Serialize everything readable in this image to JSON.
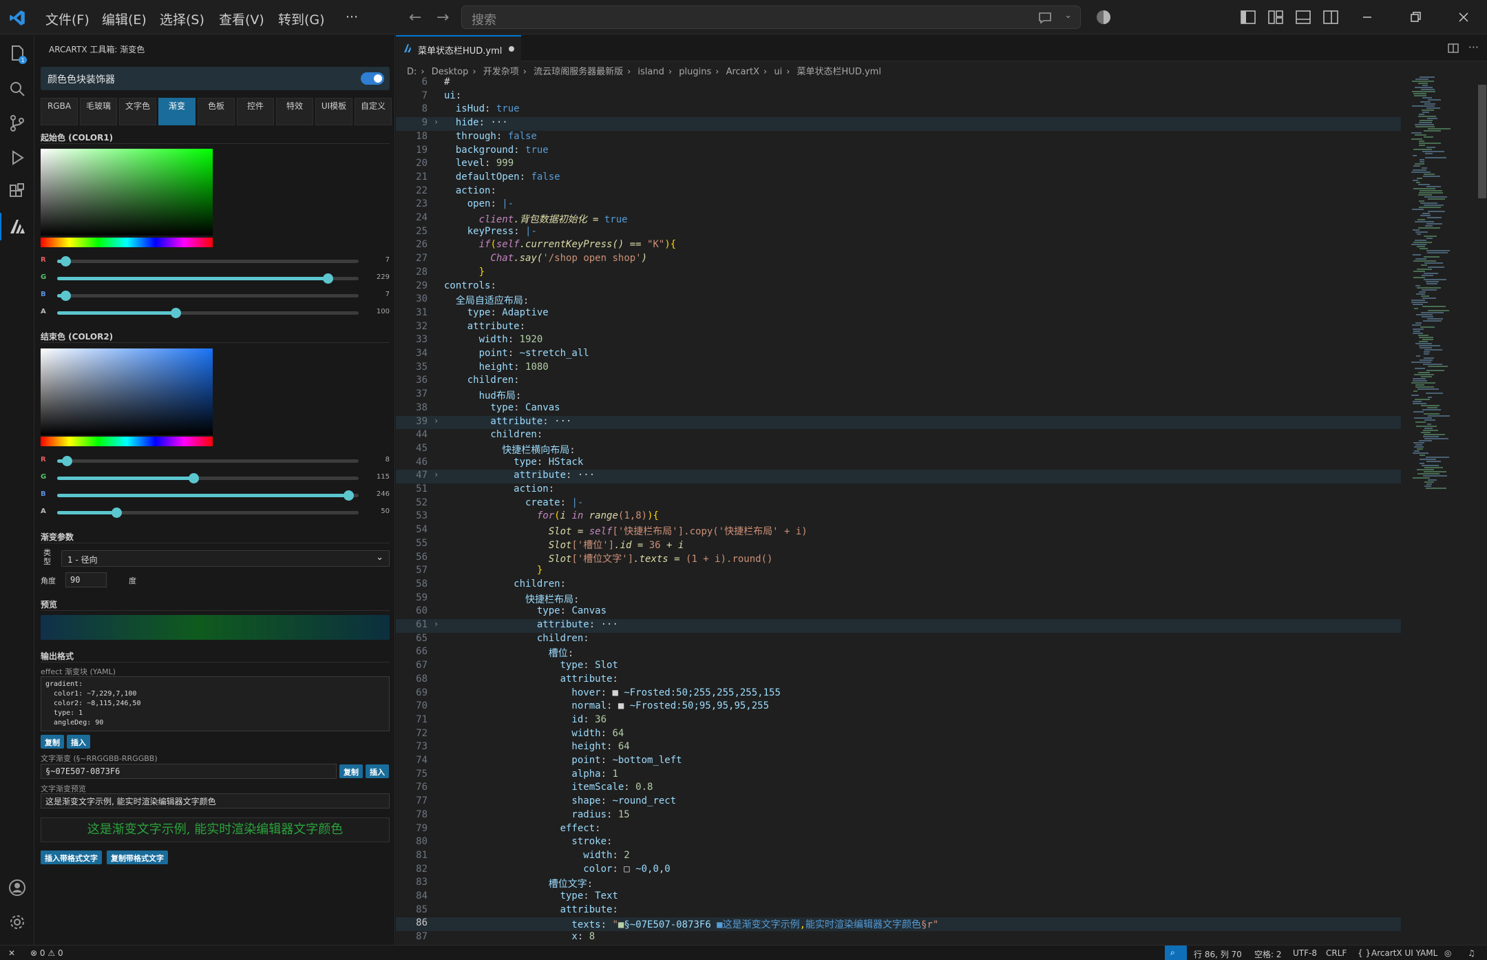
{
  "titlebar": {
    "menu": [
      "文件(F)",
      "编辑(E)",
      "选择(S)",
      "查看(V)",
      "转到(G)",
      "···"
    ],
    "search_placeholder": "搜索"
  },
  "side_panel": {
    "title": "ARCARTX 工具箱: 渐变色",
    "filter_label": "颜色色块装饰器",
    "filter_enabled": true,
    "tabs": [
      "RGBA",
      "毛玻璃",
      "文字色",
      "渐变",
      "色板",
      "控件",
      "特效",
      "UI模板",
      "自定义"
    ],
    "active_tab": "渐变",
    "color1": {
      "heading": "起始色 (COLOR1)",
      "r": 7,
      "g": 229,
      "b": 7,
      "a": 100,
      "r_label": "R",
      "g_label": "G",
      "b_label": "B",
      "a_label": "A",
      "r_text": "7",
      "g_text": "229",
      "b_text": "7",
      "a_text": "100"
    },
    "color2": {
      "heading": "结束色 (COLOR2)",
      "r": 8,
      "g": 115,
      "b": 246,
      "a": 50,
      "r_label": "R",
      "g_label": "G",
      "b_label": "B",
      "a_label": "A",
      "r_text": "8",
      "g_text": "115",
      "b_text": "246",
      "a_text": "50"
    },
    "gradient_params": {
      "heading": "渐变参数",
      "type_label": "类型",
      "type_value": "1 - 径向",
      "angle_label": "角度",
      "angle_value": "90",
      "angle_unit": "度"
    },
    "preview_heading": "预览",
    "output": {
      "heading": "输出格式",
      "effect_label": "effect 渐变块 (YAML)",
      "yaml": "gradient:\n  color1: ~7,229,7,100\n  color2: ~8,115,246,50\n  type: 1\n  angleDeg: 90",
      "copy": "复制",
      "insert": "插入",
      "text_grad_label": "文字渐变 (§~RRGGBB-RRGGBB)",
      "text_grad_value": "§~07E507-0873F6",
      "text_preview_label": "文字渐变预览",
      "text_preview_value": "这是渐变文字示例, 能实时渲染编辑器文字颜色",
      "rendered_text": "这是渐变文字示例, 能实时渲染编辑器文字颜色",
      "insert_formatted": "插入带格式文字",
      "copy_formatted": "复制带格式文字"
    }
  },
  "editor": {
    "tab_title": "菜单状态栏HUD.yml",
    "breadcrumb": [
      "D:",
      "Desktop",
      "开发杂项",
      "流云琼阁服务器最新版",
      "island",
      "plugins",
      "ArcartX",
      "ui",
      "菜单状态栏HUD.yml"
    ],
    "lines": [
      {
        "n": "6",
        "t": [
          [
            "#",
            "wh"
          ]
        ]
      },
      {
        "n": "7",
        "t": [
          [
            "ui",
            "k"
          ],
          [
            ":",
            "wh"
          ]
        ]
      },
      {
        "n": "8",
        "t": [
          [
            "  isHud",
            "k"
          ],
          [
            ": ",
            "wh"
          ],
          [
            "true",
            "b"
          ]
        ]
      },
      {
        "n": "9",
        "fold": true,
        "hl": true,
        "t": [
          [
            "  hide",
            "k"
          ],
          [
            ":",
            "wh"
          ],
          [
            " ···",
            "wh"
          ]
        ]
      },
      {
        "n": "18",
        "t": [
          [
            "  through",
            "k"
          ],
          [
            ": ",
            "wh"
          ],
          [
            "false",
            "b"
          ]
        ]
      },
      {
        "n": "19",
        "t": [
          [
            "  background",
            "k"
          ],
          [
            ": ",
            "wh"
          ],
          [
            "true",
            "b"
          ]
        ]
      },
      {
        "n": "20",
        "t": [
          [
            "  level",
            "k"
          ],
          [
            ": ",
            "wh"
          ],
          [
            "999",
            "n"
          ]
        ]
      },
      {
        "n": "21",
        "t": [
          [
            "  defaultOpen",
            "k"
          ],
          [
            ": ",
            "wh"
          ],
          [
            "false",
            "b"
          ]
        ]
      },
      {
        "n": "22",
        "t": [
          [
            "  action",
            "k"
          ],
          [
            ":",
            "wh"
          ]
        ]
      },
      {
        "n": "23",
        "t": [
          [
            "    open",
            "k"
          ],
          [
            ": ",
            "wh"
          ],
          [
            "|-",
            "b"
          ]
        ]
      },
      {
        "n": "24",
        "t": [
          [
            "      client",
            "c"
          ],
          [
            ".背包数据初始化 = ",
            "f"
          ],
          [
            "true",
            "b"
          ]
        ]
      },
      {
        "n": "25",
        "t": [
          [
            "    keyPress",
            "k"
          ],
          [
            ": ",
            "wh"
          ],
          [
            "|-",
            "b"
          ]
        ]
      },
      {
        "n": "26",
        "t": [
          [
            "      if",
            "c"
          ],
          [
            "(",
            "p"
          ],
          [
            "self",
            "c"
          ],
          [
            ".currentKeyPress() == ",
            "f"
          ],
          [
            "\"K\"",
            "v"
          ],
          [
            ")",
            "p"
          ],
          [
            "{",
            "p"
          ]
        ]
      },
      {
        "n": "27",
        "t": [
          [
            "        Chat",
            "c"
          ],
          [
            ".say(",
            "f"
          ],
          [
            "'/shop open shop'",
            "v"
          ],
          [
            ")",
            "f"
          ]
        ]
      },
      {
        "n": "28",
        "t": [
          [
            "      }",
            "p"
          ]
        ]
      },
      {
        "n": "29",
        "t": [
          [
            "controls",
            "k"
          ],
          [
            ":",
            "wh"
          ]
        ]
      },
      {
        "n": "30",
        "t": [
          [
            "  全局自适应布局",
            "k"
          ],
          [
            ":",
            "wh"
          ]
        ]
      },
      {
        "n": "31",
        "t": [
          [
            "    type",
            "k"
          ],
          [
            ": ",
            "wh"
          ],
          [
            "Adaptive",
            "k"
          ]
        ]
      },
      {
        "n": "32",
        "t": [
          [
            "    attribute",
            "k"
          ],
          [
            ":",
            "wh"
          ]
        ]
      },
      {
        "n": "33",
        "t": [
          [
            "      width",
            "k"
          ],
          [
            ": ",
            "wh"
          ],
          [
            "1920",
            "n"
          ]
        ]
      },
      {
        "n": "34",
        "t": [
          [
            "      point",
            "k"
          ],
          [
            ": ",
            "wh"
          ],
          [
            "~stretch_all",
            "k"
          ]
        ]
      },
      {
        "n": "35",
        "t": [
          [
            "      height",
            "k"
          ],
          [
            ": ",
            "wh"
          ],
          [
            "1080",
            "n"
          ]
        ]
      },
      {
        "n": "36",
        "t": [
          [
            "    children",
            "k"
          ],
          [
            ":",
            "wh"
          ]
        ]
      },
      {
        "n": "37",
        "t": [
          [
            "      hud布局",
            "k"
          ],
          [
            ":",
            "wh"
          ]
        ]
      },
      {
        "n": "38",
        "t": [
          [
            "        type",
            "k"
          ],
          [
            ": ",
            "wh"
          ],
          [
            "Canvas",
            "k"
          ]
        ]
      },
      {
        "n": "39",
        "fold": true,
        "hl": true,
        "t": [
          [
            "        attribute",
            "k"
          ],
          [
            ":",
            "wh"
          ],
          [
            " ···",
            "wh"
          ]
        ]
      },
      {
        "n": "44",
        "t": [
          [
            "        children",
            "k"
          ],
          [
            ":",
            "wh"
          ]
        ]
      },
      {
        "n": "45",
        "t": [
          [
            "          快捷栏横向布局",
            "k"
          ],
          [
            ":",
            "wh"
          ]
        ]
      },
      {
        "n": "46",
        "t": [
          [
            "            type",
            "k"
          ],
          [
            ": ",
            "wh"
          ],
          [
            "HStack",
            "k"
          ]
        ]
      },
      {
        "n": "47",
        "fold": true,
        "hl": true,
        "t": [
          [
            "            attribute",
            "k"
          ],
          [
            ":",
            "wh"
          ],
          [
            " ···",
            "wh"
          ]
        ]
      },
      {
        "n": "51",
        "t": [
          [
            "            action",
            "k"
          ],
          [
            ":",
            "wh"
          ]
        ]
      },
      {
        "n": "52",
        "t": [
          [
            "              create",
            "k"
          ],
          [
            ": ",
            "wh"
          ],
          [
            "|-",
            "b"
          ]
        ]
      },
      {
        "n": "53",
        "t": [
          [
            "                for",
            "c"
          ],
          [
            "(",
            "p"
          ],
          [
            "i",
            "f"
          ],
          [
            " in ",
            "c"
          ],
          [
            "range",
            "f"
          ],
          [
            "(1,8)",
            "v"
          ],
          [
            ")",
            "p"
          ],
          [
            "{",
            "p"
          ]
        ]
      },
      {
        "n": "54",
        "t": [
          [
            "                  Slot = ",
            "f"
          ],
          [
            "self",
            "c"
          ],
          [
            "['快捷栏布局'].copy('快捷栏布局' + i)",
            "v"
          ]
        ]
      },
      {
        "n": "55",
        "t": [
          [
            "                  Slot",
            "f"
          ],
          [
            "['槽位']",
            "v"
          ],
          [
            ".id = ",
            "f"
          ],
          [
            "36",
            "v"
          ],
          [
            " + i",
            "f"
          ]
        ]
      },
      {
        "n": "56",
        "t": [
          [
            "                  Slot",
            "f"
          ],
          [
            "['槽位文字']",
            "v"
          ],
          [
            ".texts = ",
            "f"
          ],
          [
            "(1 + i).round()",
            "v"
          ]
        ]
      },
      {
        "n": "57",
        "t": [
          [
            "                }",
            "p"
          ]
        ]
      },
      {
        "n": "58",
        "t": [
          [
            "            children",
            "k"
          ],
          [
            ":",
            "wh"
          ]
        ]
      },
      {
        "n": "59",
        "t": [
          [
            "              快捷栏布局",
            "k"
          ],
          [
            ":",
            "wh"
          ]
        ]
      },
      {
        "n": "60",
        "t": [
          [
            "                type",
            "k"
          ],
          [
            ": ",
            "wh"
          ],
          [
            "Canvas",
            "k"
          ]
        ]
      },
      {
        "n": "61",
        "fold": true,
        "hl": true,
        "t": [
          [
            "                attribute",
            "k"
          ],
          [
            ":",
            "wh"
          ],
          [
            " ···",
            "wh"
          ]
        ]
      },
      {
        "n": "65",
        "t": [
          [
            "                children",
            "k"
          ],
          [
            ":",
            "wh"
          ]
        ]
      },
      {
        "n": "66",
        "t": [
          [
            "                  槽位",
            "k"
          ],
          [
            ":",
            "wh"
          ]
        ]
      },
      {
        "n": "67",
        "t": [
          [
            "                    type",
            "k"
          ],
          [
            ": ",
            "wh"
          ],
          [
            "Slot",
            "k"
          ]
        ]
      },
      {
        "n": "68",
        "t": [
          [
            "                    attribute",
            "k"
          ],
          [
            ":",
            "wh"
          ]
        ]
      },
      {
        "n": "69",
        "t": [
          [
            "                      hover",
            "k"
          ],
          [
            ": ",
            "wh"
          ],
          [
            "■ ",
            "wh"
          ],
          [
            "~Frosted:50;255,255,255,155",
            "k"
          ]
        ]
      },
      {
        "n": "70",
        "t": [
          [
            "                      normal",
            "k"
          ],
          [
            ": ",
            "wh"
          ],
          [
            "■ ",
            "wh"
          ],
          [
            "~Frosted:50;95,95,95,255",
            "k"
          ]
        ]
      },
      {
        "n": "71",
        "t": [
          [
            "                      id",
            "k"
          ],
          [
            ": ",
            "wh"
          ],
          [
            "36",
            "n"
          ]
        ]
      },
      {
        "n": "72",
        "t": [
          [
            "                      width",
            "k"
          ],
          [
            ": ",
            "wh"
          ],
          [
            "64",
            "n"
          ]
        ]
      },
      {
        "n": "73",
        "t": [
          [
            "                      height",
            "k"
          ],
          [
            ": ",
            "wh"
          ],
          [
            "64",
            "n"
          ]
        ]
      },
      {
        "n": "74",
        "t": [
          [
            "                      point",
            "k"
          ],
          [
            ": ",
            "wh"
          ],
          [
            "~bottom_left",
            "k"
          ]
        ]
      },
      {
        "n": "75",
        "t": [
          [
            "                      alpha",
            "k"
          ],
          [
            ": ",
            "wh"
          ],
          [
            "1",
            "n"
          ]
        ]
      },
      {
        "n": "76",
        "t": [
          [
            "                      itemScale",
            "k"
          ],
          [
            ": ",
            "wh"
          ],
          [
            "0.8",
            "n"
          ]
        ]
      },
      {
        "n": "77",
        "t": [
          [
            "                      shape",
            "k"
          ],
          [
            ": ",
            "wh"
          ],
          [
            "~round_rect",
            "k"
          ]
        ]
      },
      {
        "n": "78",
        "t": [
          [
            "                      radius",
            "k"
          ],
          [
            ": ",
            "wh"
          ],
          [
            "15",
            "n"
          ]
        ]
      },
      {
        "n": "79",
        "t": [
          [
            "                    effect",
            "k"
          ],
          [
            ":",
            "wh"
          ]
        ]
      },
      {
        "n": "80",
        "t": [
          [
            "                      stroke",
            "k"
          ],
          [
            ":",
            "wh"
          ]
        ]
      },
      {
        "n": "81",
        "t": [
          [
            "                        width",
            "k"
          ],
          [
            ": ",
            "wh"
          ],
          [
            "2",
            "n"
          ]
        ]
      },
      {
        "n": "82",
        "t": [
          [
            "                        color",
            "k"
          ],
          [
            ": ",
            "wh"
          ],
          [
            "□ ",
            "wh"
          ],
          [
            "~0,0,0",
            "k"
          ]
        ]
      },
      {
        "n": "83",
        "t": [
          [
            "                  槽位文字",
            "k"
          ],
          [
            ":",
            "wh"
          ]
        ]
      },
      {
        "n": "84",
        "t": [
          [
            "                    type",
            "k"
          ],
          [
            ": ",
            "wh"
          ],
          [
            "Text",
            "k"
          ]
        ]
      },
      {
        "n": "85",
        "t": [
          [
            "                    attribute",
            "k"
          ],
          [
            ":",
            "wh"
          ]
        ]
      },
      {
        "n": "86",
        "cur": true,
        "hl": true,
        "t": [
          [
            "                      texts",
            "k"
          ],
          [
            ": ",
            "wh"
          ],
          [
            "\"",
            "v"
          ],
          [
            "■",
            "n"
          ],
          [
            "§~07E507-0873F6 ",
            "k"
          ],
          [
            "■",
            "b"
          ],
          [
            "这是渐变文字示例",
            "b"
          ],
          [
            ",",
            "p"
          ],
          [
            "能实时渲染编辑器文字颜色",
            "b"
          ],
          [
            "§r\"",
            "v"
          ]
        ]
      },
      {
        "n": "87",
        "t": [
          [
            "                      x",
            "k"
          ],
          [
            ": ",
            "wh"
          ],
          [
            "8",
            "n"
          ]
        ]
      }
    ]
  },
  "statusbar": {
    "errors": "0",
    "warnings": "0",
    "position": "行 86, 列 70",
    "spaces": "空格: 2",
    "encoding": "UTF-8",
    "eol": "CRLF",
    "language": "ArcartX UI YAML"
  },
  "colors": {
    "accent": "#0078d4",
    "tab_active": "#1a6c9a",
    "slider": "#5cc6cf",
    "gradient_start": "#07E507",
    "gradient_end": "#0873F6"
  }
}
